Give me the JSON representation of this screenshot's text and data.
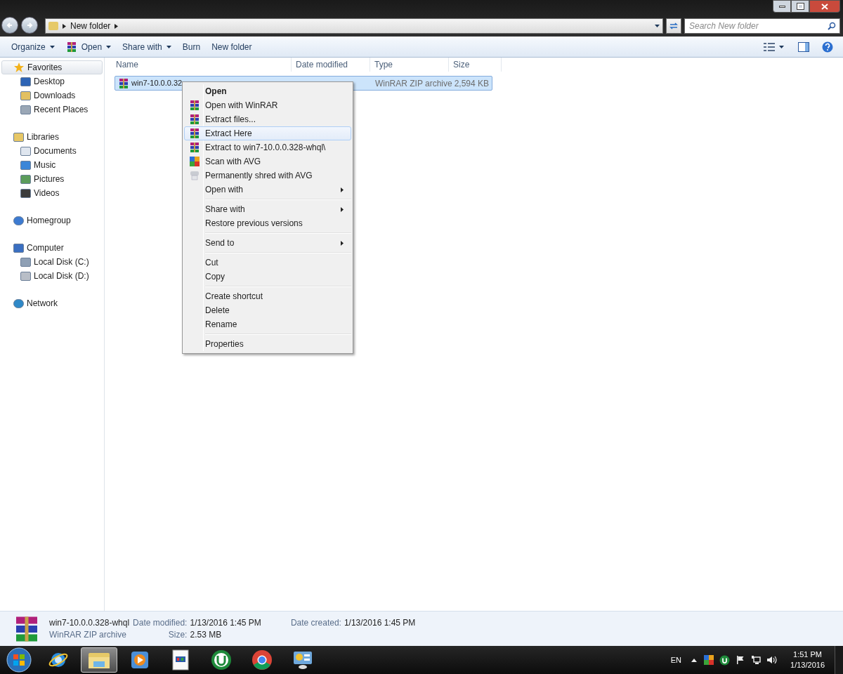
{
  "address_bar": {
    "crumbs": [
      "New folder"
    ],
    "search_placeholder": "Search New folder"
  },
  "toolbar": {
    "buttons": [
      {
        "label": "Organize",
        "dropdown": true
      },
      {
        "label": "Open",
        "dropdown": true
      },
      {
        "label": "Share with",
        "dropdown": true
      },
      {
        "label": "Burn",
        "dropdown": false
      },
      {
        "label": "New folder",
        "dropdown": false
      }
    ]
  },
  "sidebar": {
    "groups": [
      {
        "label": "Favorites",
        "selected": true,
        "children": [
          {
            "label": "Desktop"
          },
          {
            "label": "Downloads"
          },
          {
            "label": "Recent Places"
          }
        ]
      },
      {
        "label": "Libraries",
        "selected": false,
        "children": [
          {
            "label": "Documents"
          },
          {
            "label": "Music"
          },
          {
            "label": "Pictures"
          },
          {
            "label": "Videos"
          }
        ]
      },
      {
        "label": "Homegroup",
        "selected": false
      },
      {
        "label": "Computer",
        "selected": false,
        "children": [
          {
            "label": "Local Disk (C:)"
          },
          {
            "label": "Local Disk (D:)"
          }
        ]
      },
      {
        "label": "Network",
        "selected": false
      }
    ]
  },
  "file_list": {
    "columns": [
      "Name",
      "Date modified",
      "Type",
      "Size"
    ],
    "rows": [
      {
        "name": "win7-10.0.0.32",
        "type": "WinRAR ZIP archive",
        "size": "2,594 KB",
        "selected": true
      }
    ]
  },
  "context_menu": {
    "items": [
      {
        "kind": "plain",
        "label": "Open",
        "bold": true,
        "submenu": false,
        "selected": false
      },
      {
        "kind": "archive",
        "label": "Open with WinRAR",
        "bold": false,
        "submenu": false,
        "selected": false
      },
      {
        "kind": "archive",
        "label": "Extract files...",
        "bold": false,
        "submenu": false,
        "selected": false
      },
      {
        "kind": "archive",
        "label": "Extract Here",
        "bold": false,
        "submenu": false,
        "selected": true
      },
      {
        "kind": "archive",
        "label": "Extract to win7-10.0.0.328-whql\\",
        "bold": false,
        "submenu": false,
        "selected": false
      },
      {
        "kind": "scan",
        "label": "Scan with AVG",
        "bold": false,
        "submenu": false,
        "selected": false
      },
      {
        "kind": "shred",
        "label": "Permanently shred with AVG",
        "bold": false,
        "submenu": false,
        "selected": false
      },
      {
        "kind": "plain",
        "label": "Open with",
        "bold": false,
        "submenu": true,
        "selected": false
      },
      {
        "kind": "separator"
      },
      {
        "kind": "plain",
        "label": "Share with",
        "bold": false,
        "submenu": true,
        "selected": false
      },
      {
        "kind": "plain",
        "label": "Restore previous versions",
        "bold": false,
        "submenu": false,
        "selected": false
      },
      {
        "kind": "separator"
      },
      {
        "kind": "plain",
        "label": "Send to",
        "bold": false,
        "submenu": true,
        "selected": false
      },
      {
        "kind": "separator"
      },
      {
        "kind": "plain",
        "label": "Cut",
        "bold": false,
        "submenu": false,
        "selected": false
      },
      {
        "kind": "plain",
        "label": "Copy",
        "bold": false,
        "submenu": false,
        "selected": false
      },
      {
        "kind": "separator"
      },
      {
        "kind": "plain",
        "label": "Create shortcut",
        "bold": false,
        "submenu": false,
        "selected": false
      },
      {
        "kind": "plain",
        "label": "Delete",
        "bold": false,
        "submenu": false,
        "selected": false
      },
      {
        "kind": "plain",
        "label": "Rename",
        "bold": false,
        "submenu": false,
        "selected": false
      },
      {
        "kind": "separator"
      },
      {
        "kind": "plain",
        "label": "Properties",
        "bold": false,
        "submenu": false,
        "selected": false
      }
    ]
  },
  "details_pane": {
    "name": "win7-10.0.0.328-whql",
    "type": "WinRAR ZIP archive",
    "fields": [
      {
        "label": "Date modified:",
        "value": "1/13/2016 1:45 PM"
      },
      {
        "label": "Size:",
        "value": "2.53 MB"
      },
      {
        "label": "Date created:",
        "value": "1/13/2016 1:45 PM"
      }
    ]
  },
  "taskbar": {
    "apps": [
      {
        "selected": false
      },
      {
        "selected": true
      },
      {
        "selected": false
      },
      {
        "selected": false
      },
      {
        "selected": false
      },
      {
        "selected": false
      },
      {
        "selected": false
      }
    ],
    "language": "EN",
    "time": "1:51 PM",
    "date": "1/13/2016"
  }
}
